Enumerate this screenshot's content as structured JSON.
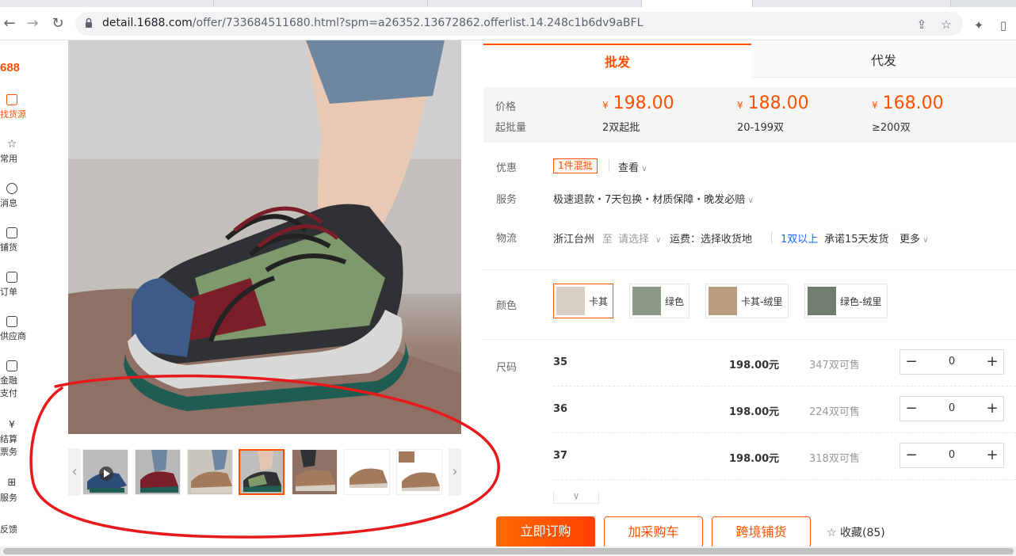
{
  "browser": {
    "url_host": "detail.1688.com",
    "url_rest": "/offer/733684511680.html?spm=a26352.13672862.offerlist.14.248c1b6dv9aBFL"
  },
  "sidebar": {
    "logo": "688",
    "items": [
      {
        "label": "找货源",
        "active": true
      },
      {
        "label": "常用"
      },
      {
        "label": "消息"
      },
      {
        "label": "铺货"
      },
      {
        "label": "订单"
      },
      {
        "label": "供应商"
      },
      {
        "label": "金融",
        "label2": "支付"
      },
      {
        "label": "结算",
        "label2": "票务"
      },
      {
        "label": "服务"
      },
      {
        "label": "反馈"
      }
    ]
  },
  "tabs": {
    "wholesale": "批发",
    "dropship": "代发"
  },
  "price": {
    "price_label": "价格",
    "moq_label": "起批量",
    "currency": "¥",
    "tiers": [
      {
        "price": "198.00",
        "qty": "2双起批"
      },
      {
        "price": "188.00",
        "qty": "20-199双"
      },
      {
        "price": "168.00",
        "qty": "≥200双"
      }
    ]
  },
  "promo": {
    "label": "优惠",
    "tag": "1件混批",
    "view": "查看"
  },
  "service": {
    "label": "服务",
    "text": "极速退款・7天包换・材质保障・晚发必赔"
  },
  "logistics": {
    "label": "物流",
    "origin": "浙江台州",
    "to": "至",
    "select": "请选择",
    "fee": "运费：选择收货地",
    "qty": "1双以上",
    "promise": "承诺15天发货",
    "more": "更多"
  },
  "color": {
    "label": "颜色",
    "options": [
      "卡其",
      "绿色",
      "卡其-绒里",
      "绿色-绒里"
    ]
  },
  "size": {
    "label": "尺码",
    "rows": [
      {
        "size": "35",
        "price": "198.00元",
        "stock": "347双可售",
        "qty": "0"
      },
      {
        "size": "36",
        "price": "198.00元",
        "stock": "224双可售",
        "qty": "0"
      },
      {
        "size": "37",
        "price": "198.00元",
        "stock": "318双可售",
        "qty": "0"
      }
    ]
  },
  "actions": {
    "buy": "立即订购",
    "cart": "加采购车",
    "cross": "跨境铺货",
    "fav": "收藏(85)"
  },
  "colors": {
    "accent": "#ff5000",
    "annotation": "#e8191b"
  }
}
